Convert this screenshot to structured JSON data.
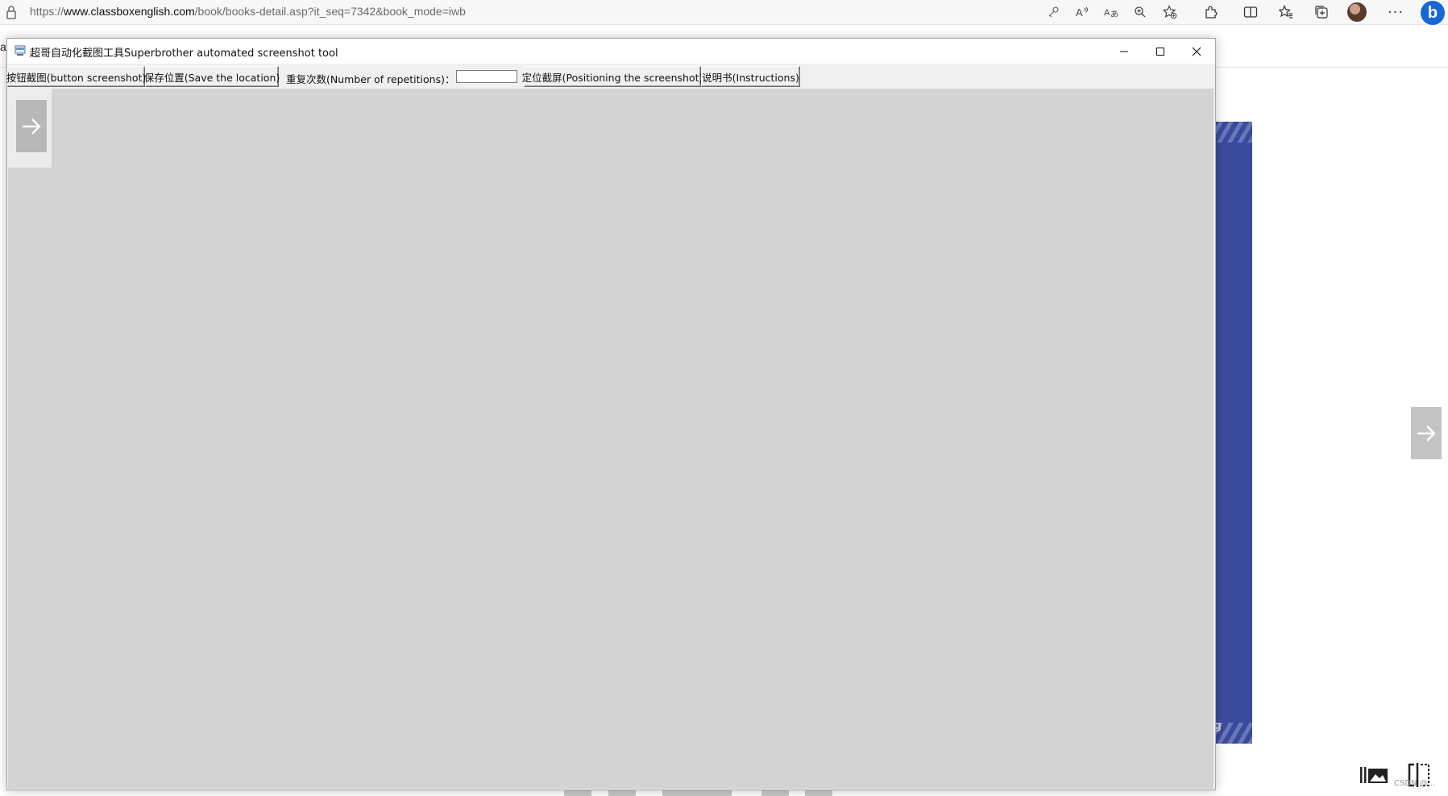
{
  "browser": {
    "url_scheme": "https://",
    "url_host": "www.classboxenglish.com",
    "url_path": "/book/books-detail.asp?it_seq=7342&book_mode=iwb",
    "side_letter": "a",
    "cover_letter": "g",
    "watermark": "CSDN @..."
  },
  "app": {
    "title": "超哥自动化截图工具Superbrother automated screenshot tool",
    "toolbar": {
      "button_screenshot": "按钮截图(button screenshot)",
      "save_location": "保存位置(Save the location)",
      "repetitions_label": "重复次数(Number of repetitions)：",
      "repetitions_value": "",
      "positioning_screenshot": "定位截屏(Positioning the screenshot)",
      "instructions": "说明书(Instructions)"
    }
  },
  "icons": [
    "lock-icon",
    "password-key-icon",
    "read-aloud-icon",
    "translate-icon",
    "zoom-icon",
    "favorite-add-icon",
    "extensions-icon",
    "split-screen-icon",
    "favorites-icon",
    "collections-icon",
    "profile-avatar",
    "more-icon",
    "bing-icon",
    "minimize-icon",
    "maximize-icon",
    "close-icon",
    "arrow-right-icon"
  ],
  "colors": {
    "canvas": "#d3d3d3",
    "cover": "#3a4b9d",
    "bing": "#1668d6"
  }
}
